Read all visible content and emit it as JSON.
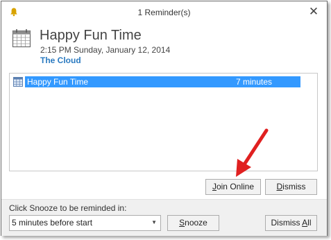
{
  "window": {
    "title": "1 Reminder(s)",
    "close_glyph": "✕"
  },
  "item": {
    "subject": "Happy Fun Time",
    "start": "2:15 PM Sunday, January 12, 2014",
    "location": "The Cloud"
  },
  "reminders": [
    {
      "subject": "Happy Fun Time",
      "due_in": "7 minutes"
    }
  ],
  "buttons": {
    "join_online": {
      "before": "",
      "accel": "J",
      "after": "oin Online"
    },
    "dismiss": {
      "before": "",
      "accel": "D",
      "after": "ismiss"
    },
    "snooze": {
      "before": "",
      "accel": "S",
      "after": "nooze"
    },
    "dismiss_all": {
      "before": "Dismiss ",
      "accel": "A",
      "after": "ll"
    }
  },
  "snooze": {
    "label": "Click Snooze to be reminded in:",
    "selected": "5 minutes before start"
  },
  "icons": {
    "window": "bell-icon",
    "item": "calendar-icon",
    "row": "appointment-icon",
    "dropdown": "chevron-down-icon",
    "annotation": "red-arrow"
  },
  "colors": {
    "selection": "#3399ff",
    "location": "#2a7ac0",
    "annotation": "#e02020",
    "bell": "#d8a300"
  }
}
